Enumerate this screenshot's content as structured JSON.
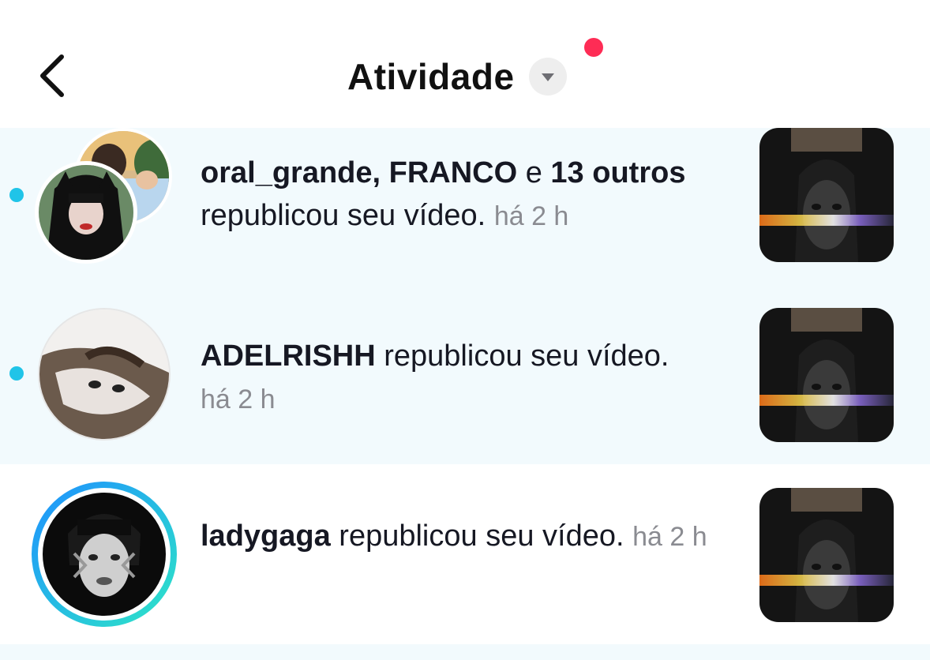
{
  "header": {
    "title": "Atividade",
    "back_icon": "chevron-left-icon",
    "dropdown_icon": "caret-down-icon",
    "notification_dot_color": "#fe2c55"
  },
  "notifications": [
    {
      "unread": true,
      "actors": "oral_grande, FRANCO",
      "joiner": " e ",
      "others": "13 outros",
      "action": "republicou seu vídeo.",
      "time": "há 2 h"
    },
    {
      "unread": true,
      "actors": "ADELRISHH",
      "action": " republicou seu vídeo.",
      "time": "há 2 h"
    },
    {
      "unread": false,
      "actors": "ladygaga",
      "action": " republicou seu vídeo.",
      "time": "há 2 h",
      "story_ring": true
    }
  ],
  "colors": {
    "unread_background": "#f2fafd",
    "unread_dot": "#20c4e8",
    "timestamp": "#8a8b91",
    "story_ring_start": "#1e90ff",
    "story_ring_end": "#2ee6c6"
  }
}
